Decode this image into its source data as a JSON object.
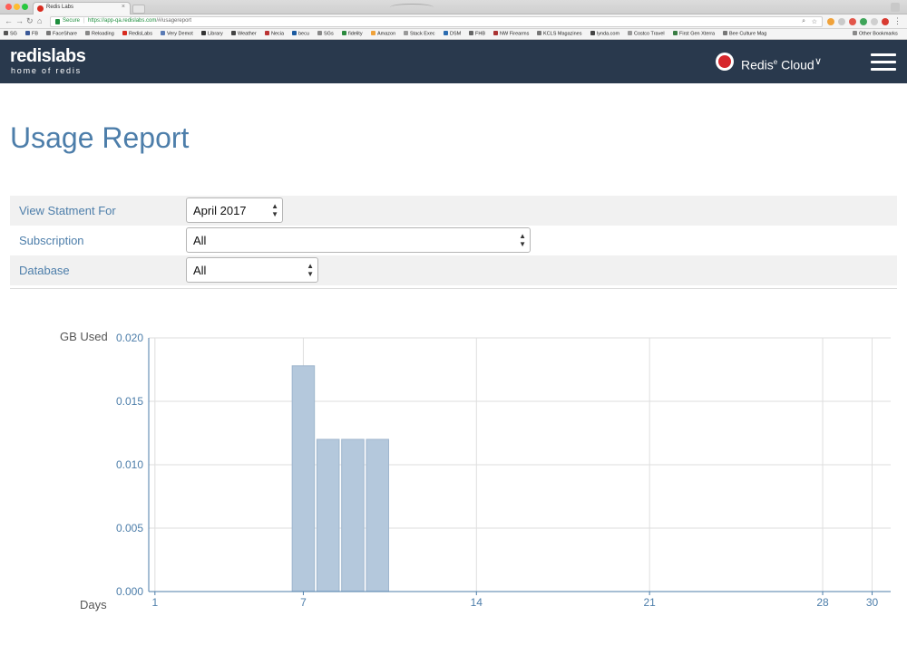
{
  "browser": {
    "tab_title": "Redis Labs",
    "secure_label": "Secure",
    "url_host": "https://app-qa.redislabs.com",
    "url_path": "/#/usagereport",
    "bookmarks": [
      "SG",
      "FB",
      "FaceShare",
      "Reloading",
      "RedisLabs",
      "Very Demot",
      "Library",
      "Weather",
      "Necia",
      "becu",
      "SGs",
      "fidelity",
      "Amazon",
      "Stack Exec",
      "DSM",
      "FHB",
      "NW Firearms",
      "KCLS Magazines",
      "lynda.com",
      "Costco Travel",
      "First Gen Xterra",
      "Bee Culture Mag"
    ],
    "other_bookmarks": "Other Bookmarks"
  },
  "header": {
    "logo": "redislabs",
    "logo_tagline": "home of redis",
    "product_label_pre": "Redis",
    "product_label_sup": "e",
    "product_label_post": " Cloud"
  },
  "page": {
    "title": "Usage Report"
  },
  "filters": {
    "statement_label": "View Statment For",
    "statement_value": "April 2017",
    "subscription_label": "Subscription",
    "subscription_value": "All",
    "database_label": "Database",
    "database_value": "All"
  },
  "chart_data": {
    "type": "bar",
    "ylabel": "GB Used",
    "xlabel": "Days",
    "ylim": [
      0,
      0.02
    ],
    "yticks": [
      "0.000",
      "0.005",
      "0.010",
      "0.015",
      "0.020"
    ],
    "xlim": [
      0.75,
      30.75
    ],
    "xticks": [
      1,
      7,
      14,
      21,
      28,
      30
    ],
    "grid": true,
    "bar_color": "#b4c8dc",
    "bars": [
      {
        "day": 7,
        "value": 0.0178
      },
      {
        "day": 8,
        "value": 0.012
      },
      {
        "day": 9,
        "value": 0.012
      },
      {
        "day": 10,
        "value": 0.012
      }
    ]
  }
}
